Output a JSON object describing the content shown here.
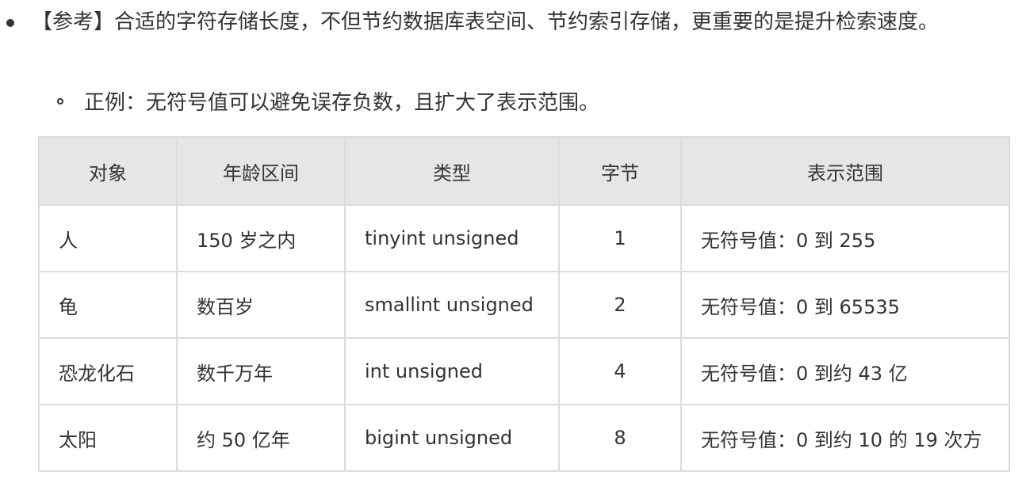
{
  "bullet": {
    "text": "【参考】合适的字符存储长度，不但节约数据库表空间、节约索引存储，更重要的是提升检索速度。"
  },
  "sub_bullet": {
    "text": "正例：无符号值可以避免误存负数，且扩大了表示范围。"
  },
  "table": {
    "headers": [
      "对象",
      "年龄区间",
      "类型",
      "字节",
      "表示范围"
    ],
    "rows": [
      {
        "object": "人",
        "age_range": "150 岁之内",
        "type": "tinyint unsigned",
        "bytes": "1",
        "range": "无符号值：0 到 255"
      },
      {
        "object": "龟",
        "age_range": "数百岁",
        "type": "smallint unsigned",
        "bytes": "2",
        "range": "无符号值：0 到 65535"
      },
      {
        "object": "恐龙化石",
        "age_range": "数千万年",
        "type": "int unsigned",
        "bytes": "4",
        "range": "无符号值：0 到约 43 亿"
      },
      {
        "object": "太阳",
        "age_range": "约 50 亿年",
        "type": "bigint unsigned",
        "bytes": "8",
        "range": "无符号值：0 到约 10 的 19 次方"
      }
    ]
  }
}
